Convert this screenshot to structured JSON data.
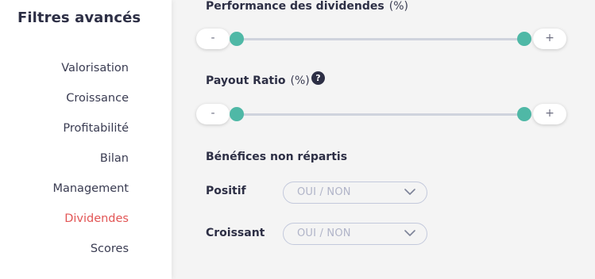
{
  "sidebar": {
    "title": "Filtres avancés",
    "items": [
      {
        "label": "Valorisation",
        "active": false
      },
      {
        "label": "Croissance",
        "active": false
      },
      {
        "label": "Profitabilité",
        "active": false
      },
      {
        "label": "Bilan",
        "active": false
      },
      {
        "label": "Management",
        "active": false
      },
      {
        "label": "Dividendes",
        "active": true
      },
      {
        "label": "Scores",
        "active": false
      }
    ]
  },
  "filters": {
    "dividend_performance": {
      "label": "Performance des dividendes",
      "unit": "(%)",
      "minus": "-",
      "plus": "+"
    },
    "payout_ratio": {
      "label": "Payout Ratio",
      "unit": "(%)",
      "help": "?",
      "minus": "-",
      "plus": "+"
    },
    "retained_earnings": {
      "label": "Bénéfices non répartis",
      "positive": {
        "label": "Positif",
        "value": "OUI / NON"
      },
      "growing": {
        "label": "Croissant",
        "value": "OUI / NON"
      }
    }
  },
  "colors": {
    "accent": "#4fb8a6",
    "active_nav": "#e25555",
    "text": "#2d2f45"
  }
}
